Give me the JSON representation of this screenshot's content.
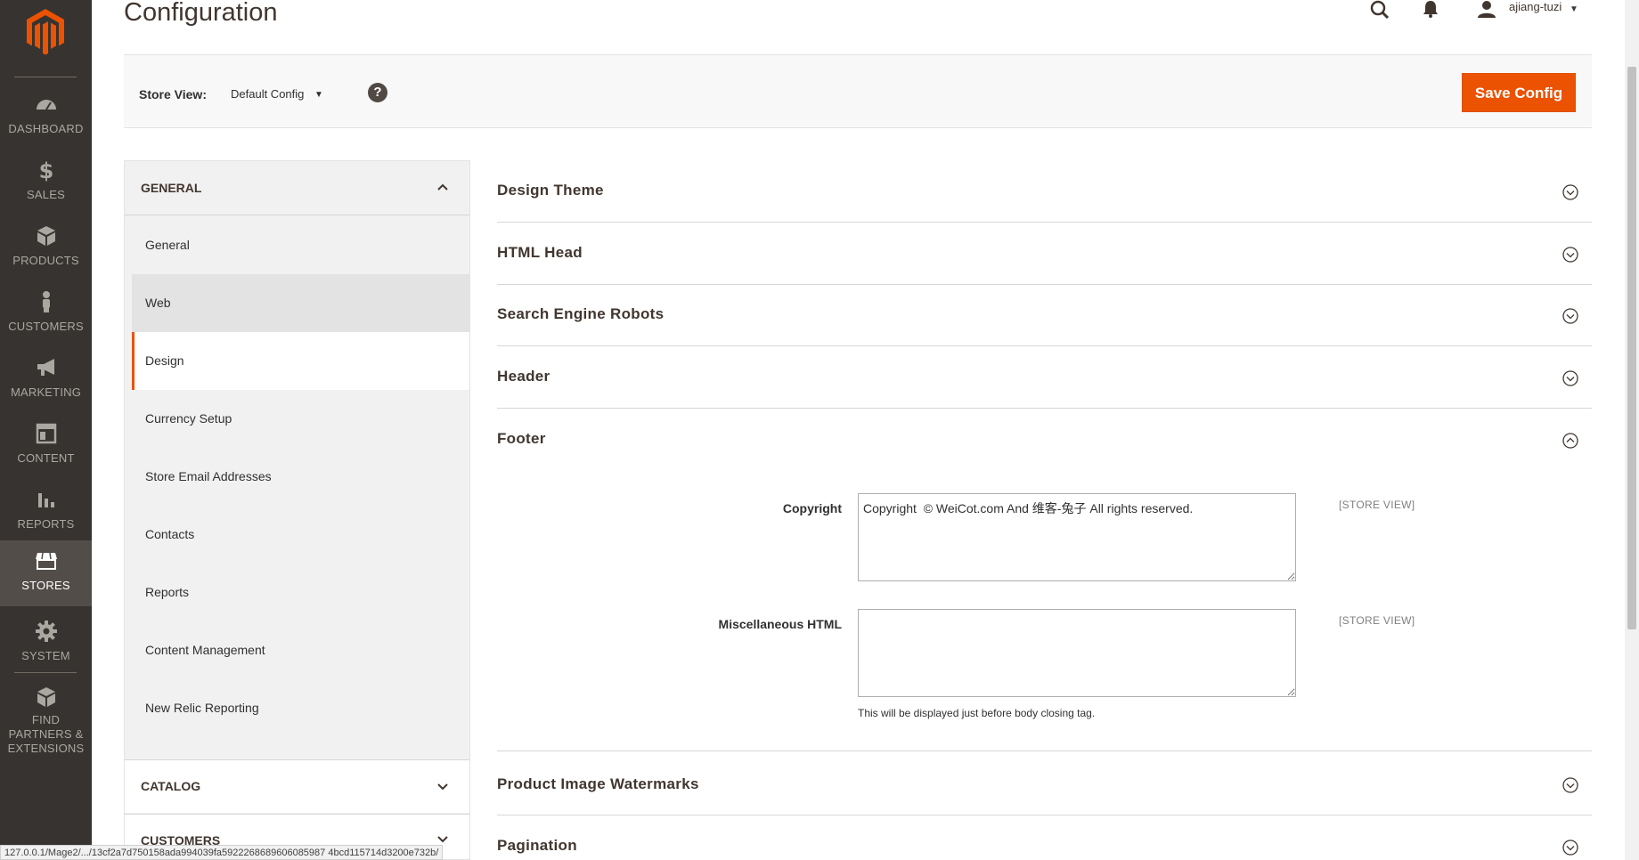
{
  "nav": {
    "items": [
      {
        "label": "DASHBOARD",
        "icon": "dashboard-icon"
      },
      {
        "label": "SALES",
        "icon": "dollar-icon"
      },
      {
        "label": "PRODUCTS",
        "icon": "cube-icon"
      },
      {
        "label": "CUSTOMERS",
        "icon": "person-icon"
      },
      {
        "label": "MARKETING",
        "icon": "megaphone-icon"
      },
      {
        "label": "CONTENT",
        "icon": "layout-icon"
      },
      {
        "label": "REPORTS",
        "icon": "bar-chart-icon"
      },
      {
        "label": "STORES",
        "icon": "storefront-icon"
      },
      {
        "label": "SYSTEM",
        "icon": "gear-icon"
      },
      {
        "label": "FIND PARTNERS & EXTENSIONS",
        "icon": "box-icon"
      }
    ],
    "active": "STORES"
  },
  "header": {
    "title": "Configuration",
    "username": "ajiang-tuzi"
  },
  "switcher": {
    "label": "Store View:",
    "value": "Default Config",
    "help": "?",
    "save_label": "Save Config"
  },
  "tabs": {
    "general_title": "GENERAL",
    "items": [
      "General",
      "Web",
      "Design",
      "Currency Setup",
      "Store Email Addresses",
      "Contacts",
      "Reports",
      "Content Management",
      "New Relic Reporting"
    ],
    "active": "Design",
    "catalog_title": "CATALOG",
    "customers_title": "CUSTOMERS"
  },
  "sections": {
    "design_theme": "Design Theme",
    "html_head": "HTML Head",
    "robots": "Search Engine Robots",
    "header": "Header",
    "footer": "Footer",
    "watermarks": "Product Image Watermarks",
    "pagination": "Pagination"
  },
  "footer_fields": {
    "copyright_label": "Copyright",
    "copyright_value": "Copyright  © WeiCot.com And 维客-兔子 All rights reserved.",
    "copyright_scope": "[STORE VIEW]",
    "misc_label": "Miscellaneous HTML",
    "misc_value": "",
    "misc_scope": "[STORE VIEW]",
    "misc_note": "This will be displayed just before body closing tag."
  },
  "status_url": "127.0.0.1/Mage2/.../13cf2a7d750158ada994039fa5922268689606085987 4bcd115714d3200e732b/"
}
